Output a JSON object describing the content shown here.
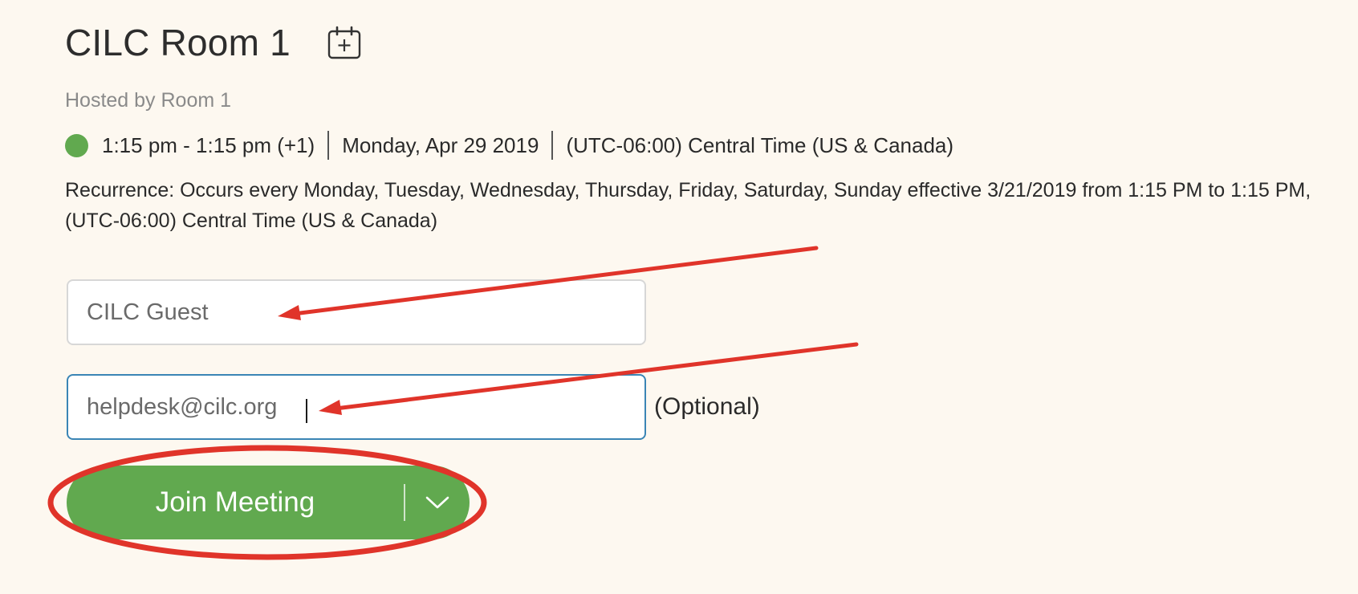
{
  "meeting": {
    "title": "CILC Room 1",
    "host": "Hosted by Room 1",
    "time": "1:15 pm - 1:15 pm (+1)",
    "date": "Monday, Apr 29 2019",
    "timezone": "(UTC-06:00) Central Time (US & Canada)",
    "recurrence": "Recurrence: Occurs every Monday, Tuesday, Wednesday, Thursday, Friday, Saturday, Sunday effective 3/21/2019 from 1:15 PM to 1:15 PM, (UTC-06:00) Central Time (US & Canada)",
    "status_color": "#61a94f"
  },
  "form": {
    "name_value": "CILC Guest",
    "email_value": "helpdesk@cilc.org",
    "optional_label": "(Optional)"
  },
  "join": {
    "label": "Join Meeting",
    "button_color": "#61a94f"
  },
  "icons": {
    "add_to_calendar": "calendar-plus-icon",
    "status": "status-dot-icon",
    "dropdown": "chevron-down-icon"
  },
  "annotation": {
    "color": "#e0342a"
  }
}
